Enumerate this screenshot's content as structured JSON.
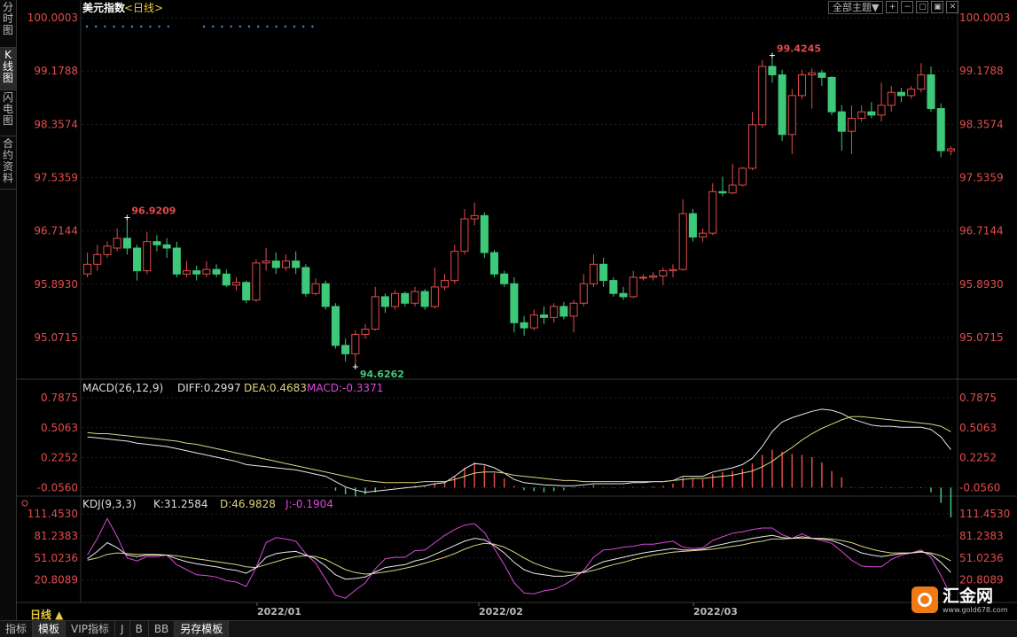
{
  "left_tabs": [
    {
      "label": "分时图"
    },
    {
      "label": "K线图",
      "active": true
    },
    {
      "label": "闪电图"
    },
    {
      "label": "合约资料"
    }
  ],
  "header": {
    "title": "美元指数",
    "period_tag": "<日线>"
  },
  "top_controls": {
    "theme_label": "全部主题▼",
    "buttons": [
      "+",
      "−",
      "▢",
      "▣",
      "✕"
    ]
  },
  "colors": {
    "up": "#e24c4c",
    "down": "#3ec97a",
    "diff": "#e8e8e8",
    "dea": "#d8d480",
    "macd": "#d94ad9",
    "k": "#e8e8e8",
    "d": "#d8d480",
    "j": "#d94ad9",
    "axis_text": "#e24c4c",
    "grid": "#222",
    "dots": "#3a8fe0",
    "label_text": "#ddd"
  },
  "main_axis": {
    "labels": [
      "100.0003",
      "99.1788",
      "98.3574",
      "97.5359",
      "96.7144",
      "95.8930",
      "95.0715"
    ],
    "min": 94.47,
    "max": 100.0003
  },
  "macd": {
    "title": "MACD(26,12,9)",
    "diff_label": "DIFF:0.2997",
    "dea_label": "DEA:0.4683",
    "macd_label": "MACD:-0.3371",
    "axis_labels": [
      "0.7875",
      "0.5063",
      "0.2252",
      "-0.0560"
    ]
  },
  "kdj": {
    "title": "KDJ(9,3,3)",
    "k_label": "K:31.2584",
    "d_label": "D:46.9828",
    "j_label": "J:-0.1904",
    "axis_labels": [
      "111.4530",
      "81.2383",
      "51.0236",
      "20.8089"
    ]
  },
  "x_axis": {
    "labels": [
      "2022/01",
      "2022/02",
      "2022/03"
    ]
  },
  "bottom_bar": {
    "period_label": "日线 ▲",
    "tabs": [
      {
        "label": "指标"
      },
      {
        "label": "模板",
        "active": true
      },
      {
        "label": "VIP指标"
      },
      {
        "label": "J"
      },
      {
        "label": "B"
      },
      {
        "label": "BB"
      },
      {
        "label": "另存模板",
        "active": true
      }
    ]
  },
  "logo": {
    "text": "汇金网",
    "url": "www.gold678.com"
  },
  "chart_data": {
    "type": "candlestick",
    "high_label": "99.4245",
    "low_label": "94.6262",
    "mid_high_label": "96.9209",
    "candles": [
      [
        96.05,
        96.2,
        96.0,
        96.38
      ],
      [
        96.2,
        96.35,
        96.1,
        96.5
      ],
      [
        96.35,
        96.48,
        96.3,
        96.55
      ],
      [
        96.45,
        96.6,
        96.4,
        96.75
      ],
      [
        96.6,
        96.45,
        96.35,
        96.92
      ],
      [
        96.45,
        96.1,
        95.95,
        96.5
      ],
      [
        96.1,
        96.55,
        96.05,
        96.7
      ],
      [
        96.55,
        96.5,
        96.4,
        96.65
      ],
      [
        96.5,
        96.45,
        96.3,
        96.6
      ],
      [
        96.45,
        96.05,
        96.0,
        96.55
      ],
      [
        96.05,
        96.1,
        96.0,
        96.25
      ],
      [
        96.1,
        96.05,
        95.95,
        96.18
      ],
      [
        96.05,
        96.12,
        96.0,
        96.25
      ],
      [
        96.12,
        96.05,
        96.0,
        96.2
      ],
      [
        96.05,
        95.88,
        95.85,
        96.12
      ],
      [
        95.88,
        95.92,
        95.8,
        96.0
      ],
      [
        95.92,
        95.65,
        95.6,
        95.95
      ],
      [
        95.65,
        96.22,
        95.62,
        96.28
      ],
      [
        96.22,
        96.25,
        96.1,
        96.45
      ],
      [
        96.25,
        96.15,
        96.05,
        96.38
      ],
      [
        96.15,
        96.25,
        96.1,
        96.35
      ],
      [
        96.25,
        96.15,
        96.05,
        96.4
      ],
      [
        96.15,
        95.75,
        95.7,
        96.2
      ],
      [
        95.75,
        95.9,
        95.72,
        95.98
      ],
      [
        95.9,
        95.55,
        95.5,
        95.95
      ],
      [
        95.55,
        94.95,
        94.9,
        95.6
      ],
      [
        94.95,
        94.82,
        94.7,
        95.05
      ],
      [
        94.82,
        95.12,
        94.62,
        95.18
      ],
      [
        95.12,
        95.2,
        95.05,
        95.28
      ],
      [
        95.2,
        95.7,
        95.18,
        95.85
      ],
      [
        95.7,
        95.55,
        95.45,
        95.75
      ],
      [
        95.55,
        95.75,
        95.5,
        95.8
      ],
      [
        95.75,
        95.6,
        95.55,
        95.78
      ],
      [
        95.6,
        95.78,
        95.55,
        95.85
      ],
      [
        95.78,
        95.55,
        95.5,
        95.82
      ],
      [
        95.55,
        95.85,
        95.52,
        96.15
      ],
      [
        95.85,
        95.95,
        95.8,
        96.05
      ],
      [
        95.95,
        96.4,
        95.9,
        96.5
      ],
      [
        96.4,
        96.9,
        96.35,
        97.05
      ],
      [
        96.9,
        96.95,
        96.8,
        97.15
      ],
      [
        96.95,
        96.38,
        96.3,
        97.0
      ],
      [
        96.38,
        96.05,
        96.0,
        96.42
      ],
      [
        96.05,
        95.9,
        95.85,
        96.1
      ],
      [
        95.9,
        95.3,
        95.15,
        96.0
      ],
      [
        95.3,
        95.22,
        95.1,
        95.4
      ],
      [
        95.22,
        95.42,
        95.18,
        95.5
      ],
      [
        95.42,
        95.38,
        95.28,
        95.55
      ],
      [
        95.38,
        95.55,
        95.3,
        95.6
      ],
      [
        95.55,
        95.4,
        95.35,
        95.62
      ],
      [
        95.4,
        95.6,
        95.15,
        95.65
      ],
      [
        95.6,
        95.9,
        95.55,
        96.05
      ],
      [
        95.9,
        96.2,
        95.85,
        96.35
      ],
      [
        96.2,
        95.95,
        95.85,
        96.3
      ],
      [
        95.95,
        95.75,
        95.7,
        96.0
      ],
      [
        95.75,
        95.7,
        95.65,
        95.85
      ],
      [
        95.7,
        96.0,
        95.68,
        96.1
      ],
      [
        96.0,
        96.0,
        95.95,
        96.05
      ],
      [
        96.0,
        96.02,
        95.95,
        96.08
      ],
      [
        96.02,
        96.1,
        95.88,
        96.15
      ],
      [
        96.1,
        96.12,
        96.0,
        96.2
      ],
      [
        96.12,
        96.98,
        96.1,
        97.2
      ],
      [
        96.98,
        96.62,
        96.55,
        97.05
      ],
      [
        96.62,
        96.68,
        96.55,
        96.75
      ],
      [
        96.68,
        97.32,
        96.65,
        97.45
      ],
      [
        97.32,
        97.3,
        97.25,
        97.55
      ],
      [
        97.3,
        97.42,
        97.28,
        97.75
      ],
      [
        97.42,
        97.68,
        97.4,
        97.7
      ],
      [
        97.68,
        98.35,
        97.65,
        98.55
      ],
      [
        98.35,
        99.25,
        98.3,
        99.35
      ],
      [
        99.25,
        99.12,
        99.0,
        99.42
      ],
      [
        99.12,
        98.2,
        98.1,
        99.2
      ],
      [
        98.2,
        98.8,
        97.9,
        98.9
      ],
      [
        98.8,
        99.12,
        98.75,
        99.2
      ],
      [
        99.12,
        99.15,
        98.6,
        99.22
      ],
      [
        99.15,
        99.08,
        98.95,
        99.2
      ],
      [
        99.08,
        98.55,
        98.5,
        99.1
      ],
      [
        98.55,
        98.25,
        97.95,
        98.65
      ],
      [
        98.25,
        98.45,
        97.9,
        98.65
      ],
      [
        98.45,
        98.55,
        98.4,
        98.65
      ],
      [
        98.55,
        98.5,
        98.45,
        98.7
      ],
      [
        98.5,
        98.65,
        98.4,
        99.0
      ],
      [
        98.65,
        98.85,
        98.55,
        98.95
      ],
      [
        98.85,
        98.8,
        98.7,
        98.92
      ],
      [
        98.8,
        98.9,
        98.75,
        98.95
      ],
      [
        98.9,
        99.12,
        98.85,
        99.3
      ],
      [
        99.12,
        98.6,
        98.55,
        99.25
      ],
      [
        98.6,
        97.95,
        97.85,
        98.68
      ],
      [
        97.95,
        97.98,
        97.88,
        98.02
      ]
    ],
    "macd_bars": [
      -0.056,
      -0.056,
      -0.056,
      -0.056,
      -0.056,
      -0.056,
      -0.056,
      -0.056,
      -0.056,
      -0.056,
      -0.056,
      -0.056,
      -0.056,
      -0.056,
      -0.056,
      -0.056,
      -0.056,
      -0.056,
      -0.056,
      -0.056,
      -0.056,
      -0.056,
      -0.056,
      -0.056,
      -0.06,
      -0.085,
      -0.12,
      -0.14,
      -0.12,
      -0.1,
      -0.06,
      -0.05,
      -0.05,
      -0.04,
      -0.05,
      -0.02,
      -0.01,
      0.05,
      0.13,
      0.18,
      0.15,
      0.08,
      0.03,
      -0.04,
      -0.08,
      -0.09,
      -0.1,
      -0.09,
      -0.08,
      -0.06,
      -0.05,
      -0.03,
      -0.05,
      -0.06,
      -0.06,
      -0.05,
      -0.05,
      -0.045,
      -0.04,
      -0.02,
      0.04,
      0.03,
      0.02,
      0.07,
      0.09,
      0.1,
      0.12,
      0.17,
      0.25,
      0.3,
      0.28,
      0.26,
      0.25,
      0.23,
      0.18,
      0.1,
      0.04,
      -0.05,
      -0.06,
      -0.06,
      -0.06,
      -0.06,
      -0.06,
      -0.06,
      -0.06,
      -0.1,
      -0.2,
      -0.3371
    ],
    "macd_diff": [
      0.42,
      0.41,
      0.4,
      0.39,
      0.38,
      0.36,
      0.35,
      0.34,
      0.33,
      0.31,
      0.29,
      0.27,
      0.25,
      0.23,
      0.21,
      0.19,
      0.16,
      0.15,
      0.14,
      0.13,
      0.12,
      0.11,
      0.09,
      0.07,
      0.05,
      0.0,
      -0.05,
      -0.08,
      -0.1,
      -0.09,
      -0.08,
      -0.07,
      -0.06,
      -0.05,
      -0.04,
      -0.02,
      -0.01,
      0.05,
      0.12,
      0.17,
      0.16,
      0.13,
      0.08,
      0.02,
      -0.01,
      -0.02,
      -0.03,
      -0.035,
      -0.04,
      -0.04,
      -0.03,
      -0.02,
      -0.02,
      -0.02,
      -0.02,
      -0.01,
      -0.01,
      0.0,
      0.0,
      0.01,
      0.05,
      0.05,
      0.05,
      0.09,
      0.11,
      0.13,
      0.16,
      0.22,
      0.33,
      0.47,
      0.56,
      0.6,
      0.63,
      0.66,
      0.68,
      0.67,
      0.64,
      0.59,
      0.56,
      0.53,
      0.52,
      0.52,
      0.51,
      0.51,
      0.51,
      0.49,
      0.42,
      0.2997
    ],
    "macd_dea": [
      0.46,
      0.45,
      0.45,
      0.44,
      0.43,
      0.42,
      0.41,
      0.4,
      0.39,
      0.38,
      0.36,
      0.35,
      0.33,
      0.31,
      0.29,
      0.27,
      0.25,
      0.23,
      0.21,
      0.19,
      0.17,
      0.15,
      0.13,
      0.11,
      0.09,
      0.07,
      0.05,
      0.03,
      0.01,
      0.0,
      -0.01,
      -0.01,
      -0.01,
      -0.01,
      0.0,
      0.0,
      0.0,
      0.02,
      0.05,
      0.08,
      0.09,
      0.09,
      0.08,
      0.06,
      0.05,
      0.04,
      0.03,
      0.02,
      0.01,
      0.01,
      0.0,
      0.0,
      0.0,
      0.0,
      0.0,
      0.0,
      0.0,
      0.0,
      0.0,
      0.01,
      0.02,
      0.03,
      0.03,
      0.04,
      0.05,
      0.06,
      0.08,
      0.1,
      0.14,
      0.19,
      0.26,
      0.32,
      0.39,
      0.45,
      0.5,
      0.54,
      0.58,
      0.61,
      0.61,
      0.6,
      0.59,
      0.58,
      0.57,
      0.56,
      0.55,
      0.54,
      0.52,
      0.4683
    ],
    "kdj_k": [
      50,
      60,
      72,
      65,
      55,
      53,
      55,
      55,
      55,
      50,
      46,
      43,
      41,
      39,
      36,
      34,
      30,
      38,
      52,
      57,
      59,
      60,
      55,
      50,
      40,
      28,
      22,
      23,
      25,
      32,
      38,
      40,
      42,
      47,
      50,
      56,
      62,
      68,
      74,
      78,
      76,
      68,
      58,
      45,
      35,
      30,
      28,
      26,
      26,
      28,
      32,
      40,
      46,
      49,
      52,
      55,
      58,
      60,
      62,
      64,
      62,
      62,
      63,
      67,
      70,
      73,
      75,
      78,
      80,
      82,
      79,
      78,
      80,
      78,
      77,
      75,
      70,
      64,
      58,
      55,
      53,
      55,
      57,
      58,
      60,
      56,
      45,
      31.2584
    ],
    "kdj_d": [
      48,
      51,
      56,
      58,
      57,
      56,
      56,
      56,
      55,
      54,
      52,
      50,
      48,
      46,
      44,
      42,
      39,
      38,
      42,
      46,
      50,
      53,
      54,
      53,
      49,
      42,
      35,
      31,
      29,
      30,
      32,
      34,
      37,
      40,
      44,
      48,
      52,
      57,
      63,
      68,
      71,
      70,
      66,
      59,
      51,
      44,
      39,
      35,
      32,
      31,
      31,
      34,
      38,
      42,
      45,
      49,
      52,
      55,
      57,
      59,
      60,
      61,
      62,
      63,
      65,
      67,
      69,
      72,
      74,
      77,
      77,
      78,
      78,
      78,
      78,
      77,
      75,
      72,
      67,
      63,
      60,
      58,
      58,
      58,
      59,
      58,
      54,
      46.9828
    ],
    "kdj_j": [
      55,
      78,
      105,
      80,
      51,
      47,
      53,
      53,
      55,
      42,
      35,
      28,
      27,
      25,
      20,
      18,
      12,
      38,
      72,
      79,
      77,
      74,
      57,
      44,
      22,
      0,
      -4,
      7,
      17,
      36,
      50,
      52,
      52,
      61,
      62,
      72,
      82,
      90,
      96,
      98,
      86,
      64,
      42,
      17,
      3,
      2,
      6,
      8,
      14,
      22,
      34,
      52,
      62,
      63,
      66,
      67,
      70,
      70,
      72,
      74,
      66,
      64,
      65,
      75,
      80,
      85,
      87,
      90,
      92,
      92,
      83,
      78,
      84,
      78,
      75,
      71,
      60,
      48,
      40,
      39,
      39,
      49,
      55,
      58,
      62,
      52,
      27,
      -0.1904
    ]
  }
}
